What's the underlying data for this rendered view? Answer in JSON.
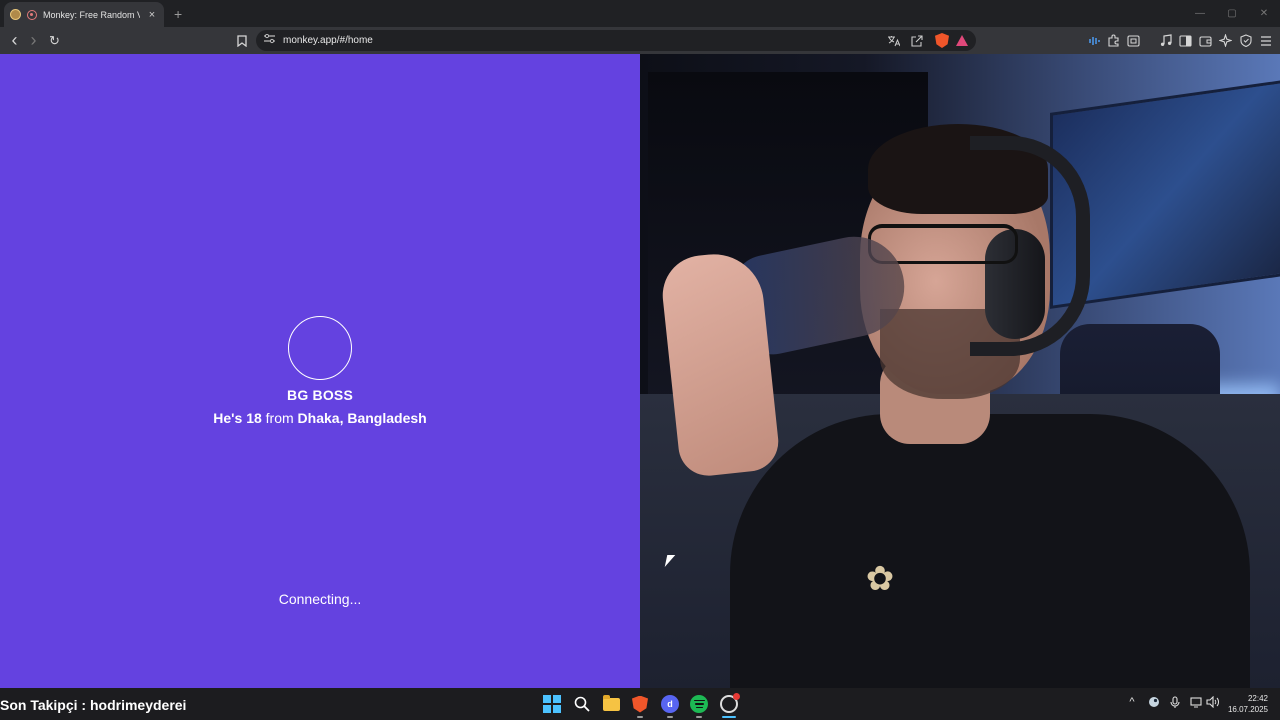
{
  "browser": {
    "tab": {
      "title": "Monkey: Free Random Video Chat",
      "close": "×"
    },
    "new_tab": "+",
    "window_controls": {
      "minimize": "—",
      "maximize": "▢",
      "close": "✕"
    },
    "nav": {
      "back": "‹",
      "forward": "›",
      "reload": "↻",
      "bookmark": "🔖"
    },
    "address": {
      "url": "monkey.app/#/home"
    }
  },
  "page": {
    "peer_name": "BG BOSS",
    "peer_pronoun": "He's",
    "peer_age": "18",
    "peer_from_word": "from",
    "peer_location": "Dhaka, Bangladesh",
    "status": "Connecting..."
  },
  "overlay": {
    "follower_text": "Son Takipçi : hodrimeyderei"
  },
  "taskbar": {
    "clock_time": "22:42",
    "clock_date": "16.07.2025",
    "discord_glyph": "d"
  },
  "colors": {
    "left_pane": "#6442e0",
    "browser_chrome": "#35363a",
    "windows_accent": "#4cc2ff"
  }
}
